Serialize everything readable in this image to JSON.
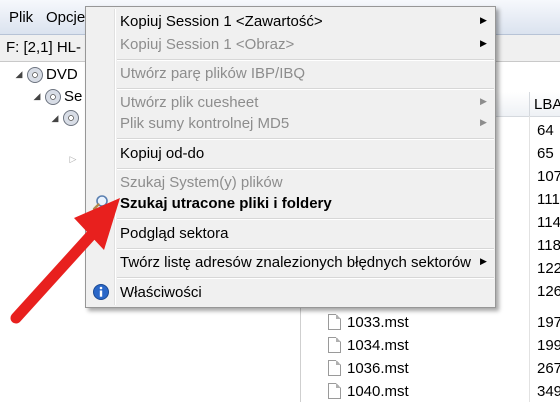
{
  "menubar": {
    "items": [
      "Plik",
      "Opcje"
    ]
  },
  "pathbar": {
    "path": "F: [2,1]  HL-"
  },
  "tree": {
    "nodes": [
      {
        "label": "DVD"
      },
      {
        "label": "Se"
      },
      {
        "label": ""
      },
      {
        "label": ""
      }
    ]
  },
  "filelist": {
    "lba_header": "LBA",
    "rows": [
      {
        "name": "",
        "lba": "64"
      },
      {
        "name": "",
        "lba": "65"
      },
      {
        "name": "",
        "lba": "107"
      },
      {
        "name": "",
        "lba": "111"
      },
      {
        "name": "",
        "lba": "114"
      },
      {
        "name": "",
        "lba": "118"
      },
      {
        "name": "",
        "lba": "122"
      },
      {
        "name": "",
        "lba": "126"
      },
      {
        "name": "1033.mst",
        "lba": "197"
      },
      {
        "name": "1034.mst",
        "lba": "199"
      },
      {
        "name": "1036.mst",
        "lba": "267"
      },
      {
        "name": "1040.mst",
        "lba": "349"
      }
    ]
  },
  "context_menu": {
    "items": [
      {
        "label": "Kopiuj Session 1  <Zawartość>",
        "enabled": true,
        "submenu": true
      },
      {
        "label": "Kopiuj Session 1  <Obraz>",
        "enabled": false,
        "submenu": true
      },
      {
        "label": "Utwórz parę plików IBP/IBQ",
        "enabled": false,
        "submenu": false
      },
      {
        "label": "Utwórz plik cuesheet",
        "enabled": false,
        "submenu": true
      },
      {
        "label": "Plik sumy kontrolnej MD5",
        "enabled": false,
        "submenu": true
      },
      {
        "label": "Kopiuj od-do",
        "enabled": true,
        "submenu": false
      },
      {
        "label": "Szukaj System(y) plików",
        "enabled": false,
        "submenu": false
      },
      {
        "label": "Szukaj utracone pliki i foldery",
        "enabled": true,
        "submenu": false,
        "icon": "magnifier-icon"
      },
      {
        "label": "Podgląd sektora",
        "enabled": true,
        "submenu": false
      },
      {
        "label": "Twórz listę adresów znalezionych błędnych sektorów",
        "enabled": true,
        "submenu": true
      },
      {
        "label": "Właściwości",
        "enabled": true,
        "submenu": false,
        "icon": "info-icon"
      }
    ]
  },
  "annotation": {
    "arrow_color": "#e8201e"
  }
}
